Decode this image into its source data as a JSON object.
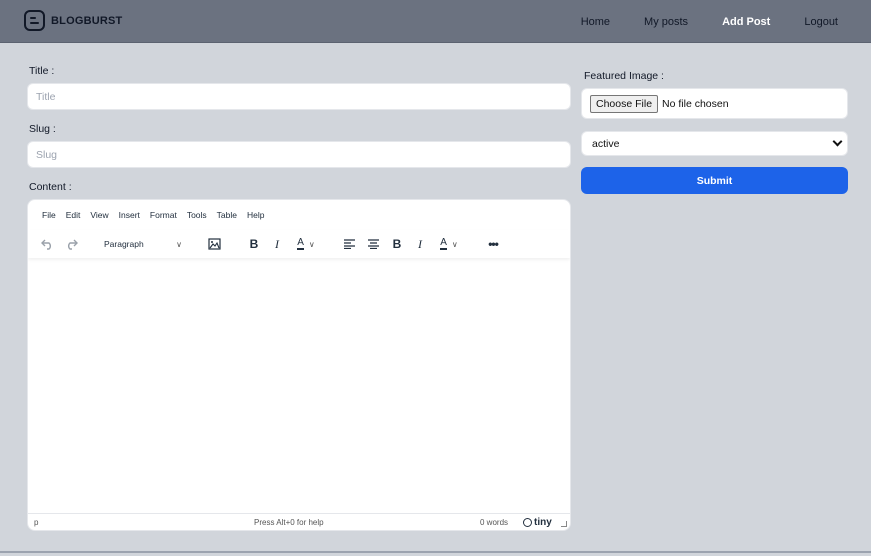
{
  "header": {
    "brand": "BLOGBURST",
    "nav": [
      {
        "label": "Home",
        "active": false
      },
      {
        "label": "My posts",
        "active": false
      },
      {
        "label": "Add Post",
        "active": true
      },
      {
        "label": "Logout",
        "active": false
      }
    ]
  },
  "form": {
    "title_label": "Title :",
    "title_placeholder": "Title",
    "slug_label": "Slug :",
    "slug_placeholder": "Slug",
    "content_label": "Content :",
    "featured_image_label": "Featured Image :",
    "file_button": "Choose File",
    "file_status": "No file chosen",
    "status_value": "active",
    "submit_label": "Submit"
  },
  "editor": {
    "menu": [
      "File",
      "Edit",
      "View",
      "Insert",
      "Format",
      "Tools",
      "Table",
      "Help"
    ],
    "block_format": "Paragraph",
    "status_path": "p",
    "help_text": "Press Alt+0 for help",
    "word_count": "0 words",
    "brand": "tiny"
  },
  "colors": {
    "header_bg": "#6b7280",
    "page_bg": "#d1d5db",
    "submit_bg": "#1d63e9"
  }
}
